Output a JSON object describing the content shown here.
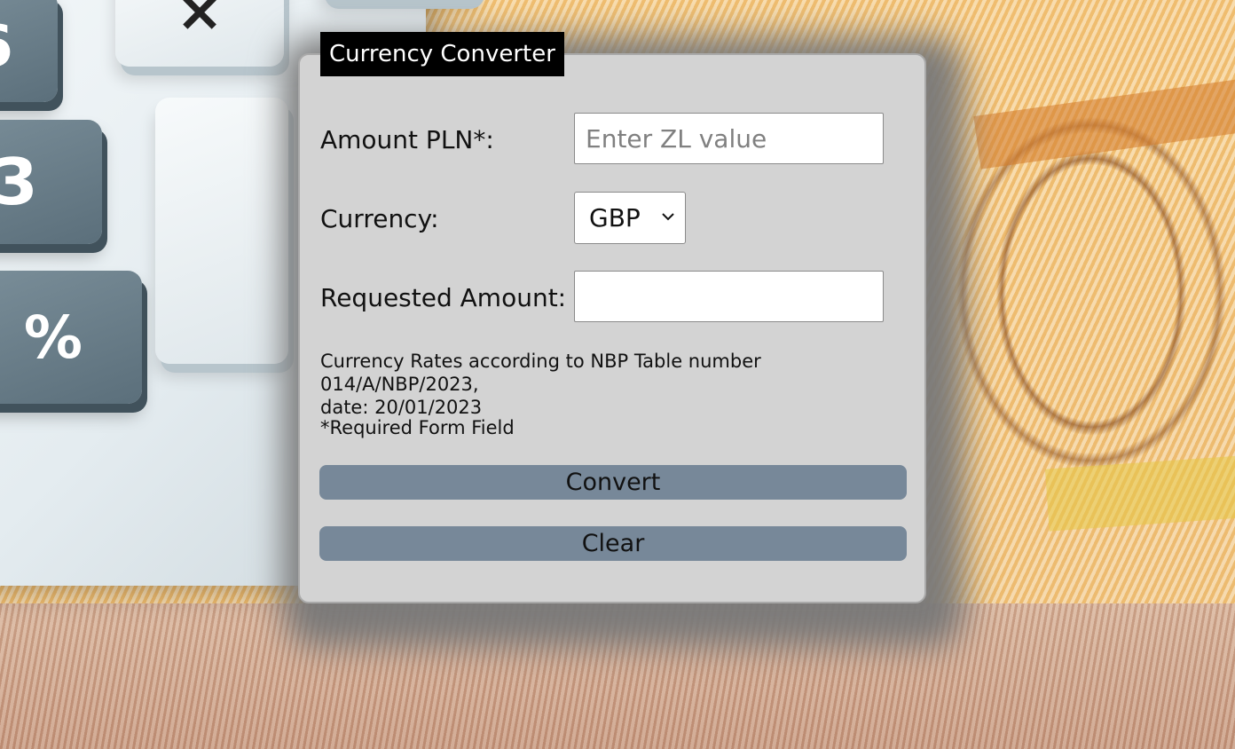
{
  "title": "Currency Converter",
  "form": {
    "amount_label": "Amount PLN*:",
    "amount_placeholder": "Enter ZL value",
    "amount_value": "",
    "currency_label": "Currency:",
    "currency_selected": "GBP",
    "requested_label": "Requested Amount:",
    "requested_value": ""
  },
  "info": {
    "rates_line1": "Currency Rates according to NBP Table number 014/A/NBP/2023,",
    "rates_line2": "date: 20/01/2023",
    "required_note": "*Required Form Field"
  },
  "buttons": {
    "convert": "Convert",
    "clear": "Clear"
  },
  "background": {
    "calculator_keys": [
      "6",
      "3",
      "%",
      "×",
      "÷"
    ]
  },
  "colors": {
    "panel": "#d3d3d3",
    "button": "#778899",
    "title_bg": "#000000",
    "title_text": "#ffffff"
  }
}
